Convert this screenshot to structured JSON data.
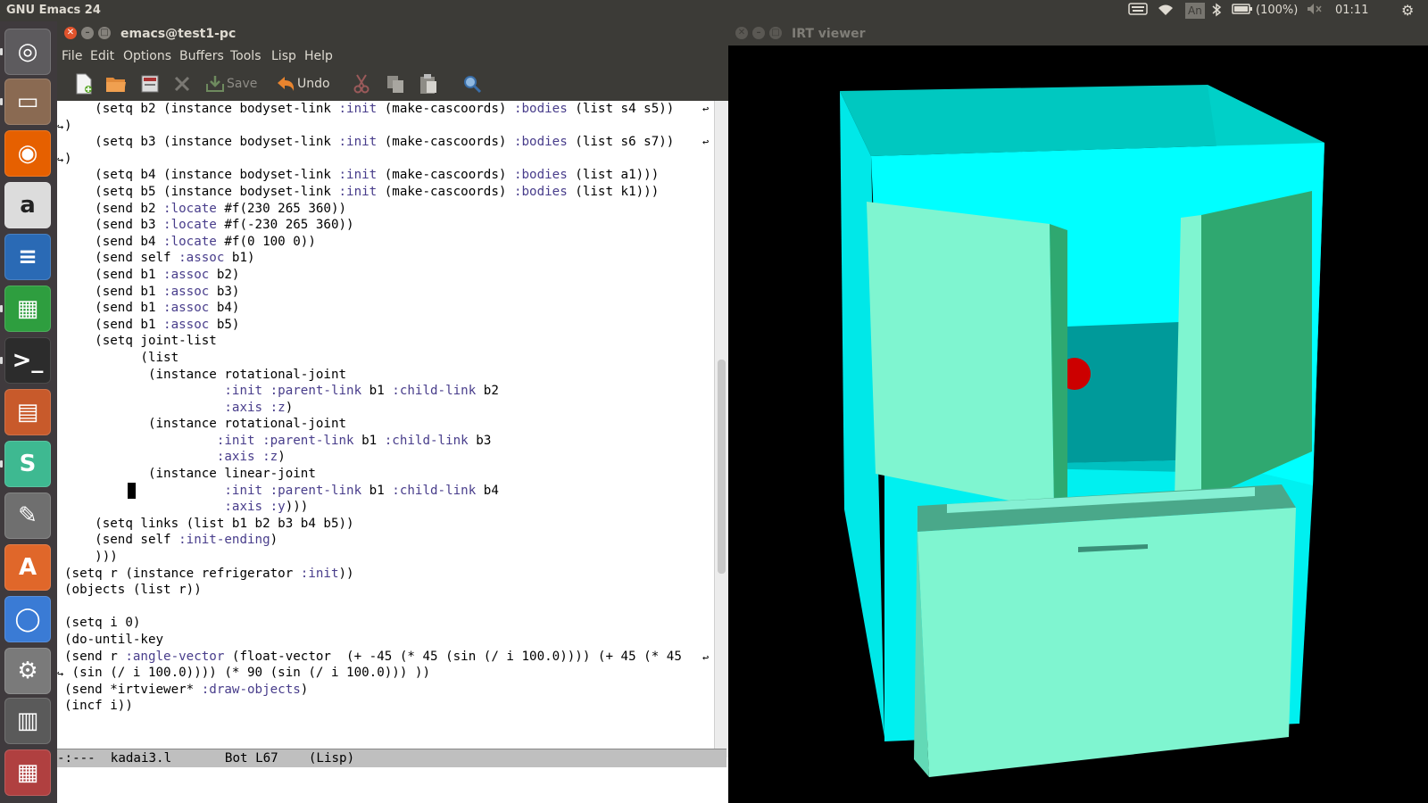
{
  "topbar": {
    "app_title": "GNU Emacs 24",
    "keyboard_layout": "An",
    "battery": "(100%)",
    "clock": "01:11"
  },
  "launcher": {
    "items": [
      {
        "name": "dash-home-icon",
        "glyph": "◎",
        "color": "#5d5b5e"
      },
      {
        "name": "files-icon",
        "glyph": "▭",
        "color": "#8a6a52"
      },
      {
        "name": "firefox-icon",
        "glyph": "◉",
        "color": "#e66000"
      },
      {
        "name": "amazon-icon",
        "glyph": "a",
        "color": "#dcdcdc"
      },
      {
        "name": "writer-icon",
        "glyph": "≡",
        "color": "#2a6ab5"
      },
      {
        "name": "calc-icon",
        "glyph": "▦",
        "color": "#2e9e3f"
      },
      {
        "name": "terminal-icon",
        "glyph": ">_",
        "color": "#2c2c2c"
      },
      {
        "name": "impress-icon",
        "glyph": "▤",
        "color": "#c85a2b"
      },
      {
        "name": "slack-icon",
        "glyph": "S",
        "color": "#3eb991"
      },
      {
        "name": "text-editor-icon",
        "glyph": "✎",
        "color": "#6f6f6f"
      },
      {
        "name": "software-center-icon",
        "glyph": "A",
        "color": "#e0672a"
      },
      {
        "name": "chromium-icon",
        "glyph": "◯",
        "color": "#3a7bd5"
      },
      {
        "name": "system-settings-icon",
        "glyph": "⚙",
        "color": "#7a7a7a"
      },
      {
        "name": "workspace-icon",
        "glyph": "▥",
        "color": "#5a5a5a"
      },
      {
        "name": "trash-icon",
        "glyph": "▦",
        "color": "#b04040"
      }
    ]
  },
  "emacs": {
    "window_title": "emacs@test1-pc",
    "menu": [
      "File",
      "Edit",
      "Options",
      "Buffers",
      "Tools",
      "Lisp",
      "Help"
    ],
    "toolbar": {
      "save_label": "Save",
      "undo_label": "Undo"
    },
    "code_lines": [
      [
        [
          "    (setq b2 (instance bodyset-link ",
          ""
        ],
        [
          ":init",
          "kw"
        ],
        [
          " (make-cascoords) ",
          ""
        ],
        [
          ":bodies",
          "kw"
        ],
        [
          " (list s4 s5))",
          ""
        ]
      ],
      [
        [
          ")",
          ""
        ]
      ],
      [
        [
          "    (setq b3 (instance bodyset-link ",
          ""
        ],
        [
          ":init",
          "kw"
        ],
        [
          " (make-cascoords) ",
          ""
        ],
        [
          ":bodies",
          "kw"
        ],
        [
          " (list s6 s7))",
          ""
        ]
      ],
      [
        [
          ")",
          ""
        ]
      ],
      [
        [
          "    (setq b4 (instance bodyset-link ",
          ""
        ],
        [
          ":init",
          "kw"
        ],
        [
          " (make-cascoords) ",
          ""
        ],
        [
          ":bodies",
          "kw"
        ],
        [
          " (list a1)))",
          ""
        ]
      ],
      [
        [
          "    (setq b5 (instance bodyset-link ",
          ""
        ],
        [
          ":init",
          "kw"
        ],
        [
          " (make-cascoords) ",
          ""
        ],
        [
          ":bodies",
          "kw"
        ],
        [
          " (list k1)))",
          ""
        ]
      ],
      [
        [
          "    (send b2 ",
          ""
        ],
        [
          ":locate",
          "kw"
        ],
        [
          " #f(230 265 360))",
          ""
        ]
      ],
      [
        [
          "    (send b3 ",
          ""
        ],
        [
          ":locate",
          "kw"
        ],
        [
          " #f(-230 265 360))",
          ""
        ]
      ],
      [
        [
          "    (send b4 ",
          ""
        ],
        [
          ":locate",
          "kw"
        ],
        [
          " #f(0 100 0))",
          ""
        ]
      ],
      [
        [
          "    (send self ",
          ""
        ],
        [
          ":assoc",
          "kw"
        ],
        [
          " b1)",
          ""
        ]
      ],
      [
        [
          "    (send b1 ",
          ""
        ],
        [
          ":assoc",
          "kw"
        ],
        [
          " b2)",
          ""
        ]
      ],
      [
        [
          "    (send b1 ",
          ""
        ],
        [
          ":assoc",
          "kw"
        ],
        [
          " b3)",
          ""
        ]
      ],
      [
        [
          "    (send b1 ",
          ""
        ],
        [
          ":assoc",
          "kw"
        ],
        [
          " b4)",
          ""
        ]
      ],
      [
        [
          "    (send b1 ",
          ""
        ],
        [
          ":assoc",
          "kw"
        ],
        [
          " b5)",
          ""
        ]
      ],
      [
        [
          "    (setq joint-list",
          ""
        ]
      ],
      [
        [
          "          (list",
          ""
        ]
      ],
      [
        [
          "           (instance rotational-joint",
          ""
        ]
      ],
      [
        [
          "                     ",
          ""
        ],
        [
          ":init :parent-link",
          "kw"
        ],
        [
          " b1 ",
          ""
        ],
        [
          ":child-link",
          "kw"
        ],
        [
          " b2",
          ""
        ]
      ],
      [
        [
          "                     ",
          ""
        ],
        [
          ":axis :z",
          "kw"
        ],
        [
          ")",
          ""
        ]
      ],
      [
        [
          "           (instance rotational-joint",
          ""
        ]
      ],
      [
        [
          "                    ",
          ""
        ],
        [
          ":init :parent-link",
          "kw"
        ],
        [
          " b1 ",
          ""
        ],
        [
          ":child-link",
          "kw"
        ],
        [
          " b3",
          ""
        ]
      ],
      [
        [
          "                    ",
          ""
        ],
        [
          ":axis :z",
          "kw"
        ],
        [
          ")",
          ""
        ]
      ],
      [
        [
          "           (instance linear-joint",
          ""
        ]
      ],
      [
        [
          "                     ",
          ""
        ],
        [
          ":init :parent-link",
          "kw"
        ],
        [
          " b1 ",
          ""
        ],
        [
          ":child-link",
          "kw"
        ],
        [
          " b4",
          ""
        ]
      ],
      [
        [
          "                     ",
          ""
        ],
        [
          ":axis :y",
          "kw"
        ],
        [
          ")))",
          ""
        ]
      ],
      [
        [
          "    (setq links (list b1 b2 b3 b4 b5))",
          ""
        ]
      ],
      [
        [
          "    (send self ",
          ""
        ],
        [
          ":init-ending",
          "kw"
        ],
        [
          ")",
          ""
        ]
      ],
      [
        [
          "    )))",
          ""
        ]
      ],
      [
        [
          "(setq r (instance refrigerator ",
          ""
        ],
        [
          ":init",
          "kw"
        ],
        [
          "))",
          ""
        ]
      ],
      [
        [
          "(objects (list r))",
          ""
        ]
      ],
      [
        [
          "",
          ""
        ]
      ],
      [
        [
          "(setq i 0)",
          ""
        ]
      ],
      [
        [
          "(do-until-key",
          ""
        ]
      ],
      [
        [
          "(send r ",
          ""
        ],
        [
          ":angle-vector",
          "kw"
        ],
        [
          " (float-vector  (+ -45 (* 45 (sin (/ i 100.0)))) (+ 45 (* 45",
          ""
        ]
      ],
      [
        [
          " (sin (/ i 100.0)))) (* 90 (sin (/ i 100.0))) ))",
          ""
        ]
      ],
      [
        [
          "(send *irtviewer* ",
          ""
        ],
        [
          ":draw-objects",
          "kw"
        ],
        [
          ")",
          ""
        ]
      ],
      [
        [
          "(incf i))",
          ""
        ]
      ]
    ],
    "modeline": "-:---  kadai3.l       Bot L67    (Lisp)"
  },
  "irt": {
    "window_title": "IRT viewer"
  }
}
